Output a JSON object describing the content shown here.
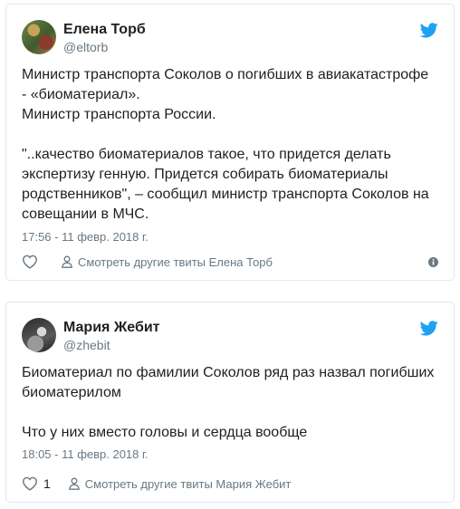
{
  "tweets": [
    {
      "author_name": "Елена Торб",
      "handle": "@eltorb",
      "text": "Министр транспорта Соколов о погибших в авиакатастрофе\n- «биоматериал».\nМинистр транспорта России.\n\n\"..качество биоматериалов такое, что придется делать\nэкспертизу генную. Придется собирать биоматериалы\nродственников\", – сообщил министр транспорта Соколов на\nсовещании в МЧС.",
      "timestamp": "17:56 - 11 февр. 2018 г.",
      "likes": "",
      "more_link": "Смотреть другие твиты Елена Торб"
    },
    {
      "author_name": "Мария Жебит",
      "handle": "@zhebit",
      "text": "Биоматериал по фамилии Соколов ряд раз назвал погибших\nбиоматерилом\n\nЧто у них вместо головы и сердца вообще",
      "timestamp": "18:05 - 11 февр. 2018 г.",
      "likes": "1",
      "more_link": "Смотреть другие твиты Мария Жебит"
    }
  ],
  "icons": {
    "brand": "twitter-bird-icon",
    "like": "heart-icon",
    "profile": "person-icon",
    "info": "info-icon"
  },
  "colors": {
    "twitter_blue": "#1da1f2",
    "meta_gray": "#697882",
    "border": "#e1e8ed",
    "text": "#1c2022"
  }
}
